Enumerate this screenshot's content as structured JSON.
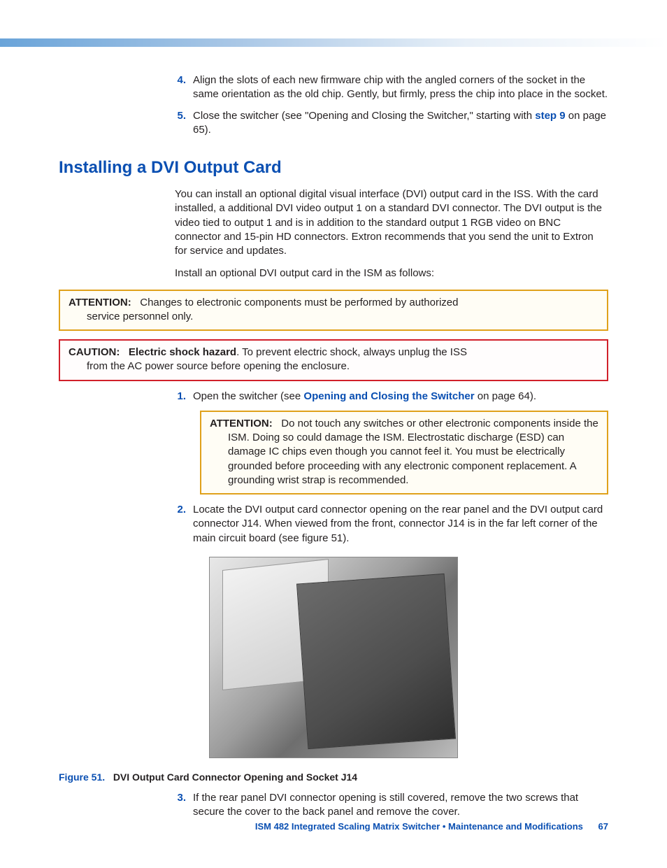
{
  "steps_top": [
    {
      "num": "4.",
      "text": "Align the slots of each new firmware chip with the angled corners of the socket in the same orientation as the old chip. Gently, but firmly, press the chip into place in the socket."
    },
    {
      "num": "5.",
      "pre": "Close the switcher (see \"Opening and Closing the Switcher,\" starting with ",
      "link": "step 9",
      "post": " on page 65)."
    }
  ],
  "heading": "Installing a DVI Output Card",
  "intro": "You can install an optional digital visual interface (DVI) output card in the ISS. With the card installed, a additional DVI video output 1 on a standard DVI connector. The DVI output is the video tied to output 1 and is in addition to the standard output 1 RGB video on BNC connector and 15-pin HD connectors. Extron recommends that you send the unit to Extron for service and updates.",
  "intro2": "Install an optional DVI output card in the ISM as follows:",
  "attn1": {
    "label": "ATTENTION:",
    "first": "Changes to electronic components must be performed by authorized",
    "cont": "service personnel only."
  },
  "caut": {
    "label": "CAUTION:",
    "boldpart": "Electric shock hazard",
    "first": ". To prevent electric shock, always unplug the ISS",
    "cont": "from the AC power source before opening the enclosure."
  },
  "step1": {
    "num": "1.",
    "pre": "Open the switcher (see ",
    "link": "Opening and Closing the Switcher",
    "post": " on page 64)."
  },
  "attn2": {
    "label": "ATTENTION:",
    "first": "Do not touch any switches or other electronic components inside the",
    "cont": "ISM. Doing so could damage the ISM. Electrostatic discharge (ESD) can damage IC chips even though you cannot feel it. You must be electrically grounded before proceeding with any electronic component replacement. A grounding wrist strap is recommended."
  },
  "step2": {
    "num": "2.",
    "text": "Locate the DVI output card connector opening on the rear panel and the DVI output card connector J14. When viewed from the front, connector J14 is in the far left corner of the main circuit board (see figure 51)."
  },
  "figure": {
    "label": "Figure 51.",
    "title": "DVI Output Card Connector Opening and Socket J14"
  },
  "step3": {
    "num": "3.",
    "text": "If the rear panel DVI connector opening is still covered, remove the two screws that secure the cover to the back panel and remove the cover."
  },
  "footer": {
    "title": "ISM 482 Integrated Scaling Matrix Switcher • Maintenance and Modifications",
    "page": "67"
  }
}
